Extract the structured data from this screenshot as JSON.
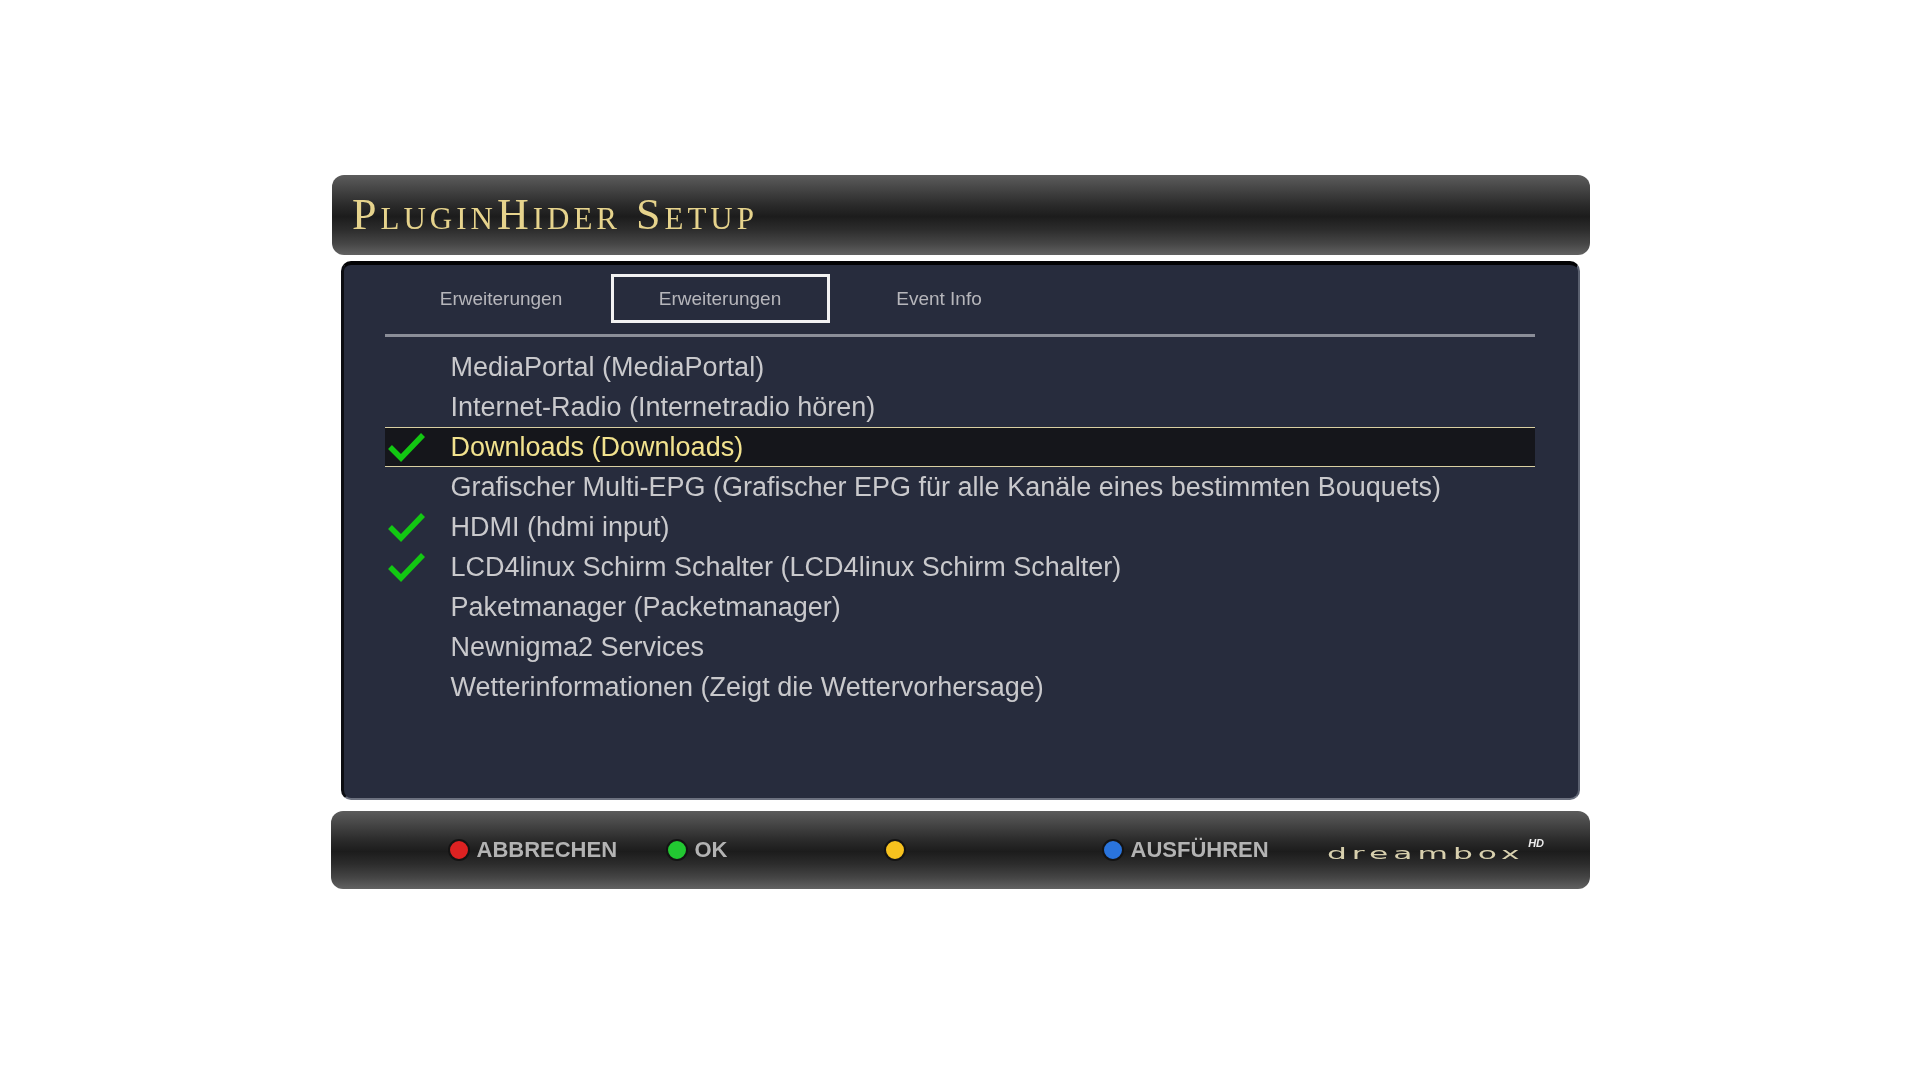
{
  "window": {
    "title": "PluginHider Setup"
  },
  "tabs": [
    {
      "label": "Erweiterungen",
      "selected": false
    },
    {
      "label": "Erweiterungen",
      "selected": true
    },
    {
      "label": "Event Info",
      "selected": false
    }
  ],
  "plugins": [
    {
      "label": "MediaPortal (MediaPortal)",
      "checked": false,
      "selected": false
    },
    {
      "label": "Internet-Radio (Internetradio hören)",
      "checked": false,
      "selected": false
    },
    {
      "label": "Downloads (Downloads)",
      "checked": true,
      "selected": true
    },
    {
      "label": "Grafischer Multi-EPG (Grafischer EPG für alle Kanäle eines bestimmten Bouquets)",
      "checked": false,
      "selected": false
    },
    {
      "label": "HDMI (hdmi input)",
      "checked": true,
      "selected": false
    },
    {
      "label": "LCD4linux Schirm Schalter (LCD4linux Schirm Schalter)",
      "checked": true,
      "selected": false
    },
    {
      "label": "Paketmanager (Packetmanager)",
      "checked": false,
      "selected": false
    },
    {
      "label": "Newnigma2 Services",
      "checked": false,
      "selected": false
    },
    {
      "label": "Wetterinformationen (Zeigt die Wettervorhersage)",
      "checked": false,
      "selected": false
    }
  ],
  "color_buttons": [
    {
      "label": "ABBRECHEN",
      "color": "#dd2222"
    },
    {
      "label": "OK",
      "color": "#22c832"
    },
    {
      "color": "#f7c21e"
    },
    {
      "label": "AUSFÜHREN",
      "color": "#2a74dc"
    }
  ],
  "logo": {
    "text": "dreambox",
    "badge": "HD"
  }
}
